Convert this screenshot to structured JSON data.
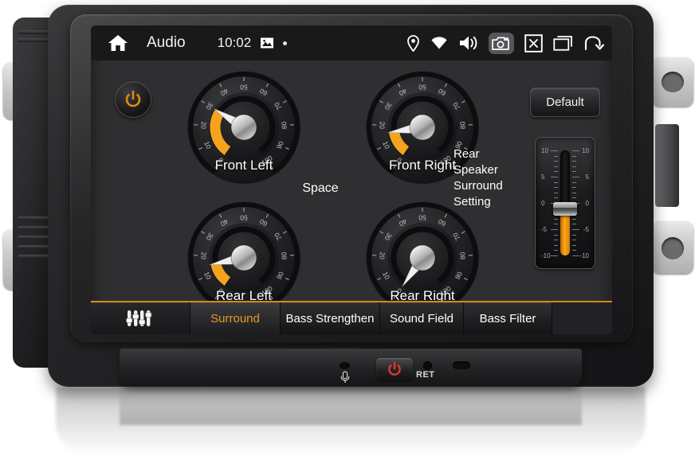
{
  "device": {
    "name": "car-head-unit",
    "hardware": {
      "power_button": "power-icon",
      "mic_label": "mic-icon",
      "reset_label": "RET"
    }
  },
  "statusbar": {
    "home_icon": "home-icon",
    "title": "Audio",
    "clock": "10:02",
    "image_icon": "image-icon",
    "dot_icon": "dot-indicator",
    "location_icon": "location-pin-icon",
    "wifi_icon": "wifi-icon",
    "volume_icon": "volume-icon",
    "camera_icon": "camera-icon",
    "close_icon": "close-box-icon",
    "recents_icon": "recent-apps-icon",
    "back_icon": "back-arrow-icon"
  },
  "screen": {
    "power_toggle": "power-icon",
    "space_label": "Space",
    "rear_setting_label": "Rear Speaker Surround Setting",
    "default_button": "Default"
  },
  "colors": {
    "accent": "#e89a28",
    "gauge_arc": "#f5a31e",
    "screen_bg": "#2f2f31",
    "statusbar_bg": "#191919",
    "tab_active_text": "#e89a28"
  },
  "gauges": [
    {
      "id": "front-left",
      "label": "Front Left",
      "value": 30,
      "min": 0,
      "max": 100,
      "ticks": [
        0,
        10,
        20,
        30,
        40,
        50,
        60,
        70,
        80,
        90,
        100
      ]
    },
    {
      "id": "front-right",
      "label": "Front Right",
      "value": 16,
      "min": 0,
      "max": 100,
      "ticks": [
        0,
        10,
        20,
        30,
        40,
        50,
        60,
        70,
        80,
        90,
        100
      ]
    },
    {
      "id": "rear-left",
      "label": "Rear Left",
      "value": 15,
      "min": 0,
      "max": 100,
      "ticks": [
        0,
        10,
        20,
        30,
        40,
        50,
        60,
        70,
        80,
        90,
        100
      ]
    },
    {
      "id": "rear-right",
      "label": "Rear Right",
      "value": 0,
      "min": 0,
      "max": 100,
      "ticks": [
        0,
        10,
        20,
        30,
        40,
        50,
        60,
        70,
        80,
        90,
        100
      ]
    }
  ],
  "slider": {
    "name": "rear-speaker-surround-slider",
    "value": -1,
    "min": -10,
    "max": 10,
    "scale_labels": [
      10,
      5,
      0,
      -5,
      -10
    ]
  },
  "tabs": [
    {
      "id": "equalizer",
      "label": "",
      "icon": "equalizer-icon",
      "active": false
    },
    {
      "id": "surround",
      "label": "Surround",
      "active": true
    },
    {
      "id": "bass-strengthen",
      "label": "Bass Strengthen",
      "active": false
    },
    {
      "id": "sound-field",
      "label": "Sound Field",
      "active": false
    },
    {
      "id": "bass-filter",
      "label": "Bass Filter",
      "active": false
    }
  ]
}
